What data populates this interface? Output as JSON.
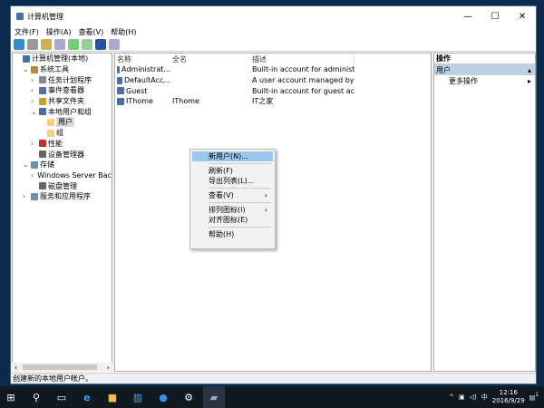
{
  "window": {
    "title": "计算机管理",
    "controls": [
      "—",
      "☐",
      "✕"
    ]
  },
  "menu": [
    "文件(F)",
    "操作(A)",
    "查看(V)",
    "帮助(H)"
  ],
  "tree": [
    {
      "label": "计算机管理(本地)",
      "indent": 0,
      "arrow": "",
      "color": "#4a6fa5"
    },
    {
      "label": "系统工具",
      "indent": 1,
      "arrow": "⌄",
      "color": "#b08a3e"
    },
    {
      "label": "任务计划程序",
      "indent": 2,
      "arrow": "›",
      "color": "#888"
    },
    {
      "label": "事件查看器",
      "indent": 2,
      "arrow": "›",
      "color": "#5a6fa0"
    },
    {
      "label": "共享文件夹",
      "indent": 2,
      "arrow": "›",
      "color": "#c8a030"
    },
    {
      "label": "本地用户和组",
      "indent": 2,
      "arrow": "⌄",
      "color": "#4a6fa5"
    },
    {
      "label": "用户",
      "indent": 3,
      "arrow": "",
      "color": "#f2d27a",
      "selected": true
    },
    {
      "label": "组",
      "indent": 3,
      "arrow": "",
      "color": "#f2d27a"
    },
    {
      "label": "性能",
      "indent": 2,
      "arrow": "›",
      "color": "#c03030"
    },
    {
      "label": "设备管理器",
      "indent": 2,
      "arrow": "",
      "color": "#666"
    },
    {
      "label": "存储",
      "indent": 1,
      "arrow": "⌄",
      "color": "#6a8fb5"
    },
    {
      "label": "Windows Server Back",
      "indent": 2,
      "arrow": "›",
      "color": "#3a9a3a"
    },
    {
      "label": "磁盘管理",
      "indent": 2,
      "arrow": "",
      "color": "#666"
    },
    {
      "label": "服务和应用程序",
      "indent": 1,
      "arrow": "›",
      "color": "#6a8fb5"
    }
  ],
  "list": {
    "headers": [
      "名称",
      "全名",
      "描述"
    ],
    "rows": [
      [
        "Administrat...",
        "",
        "Built-in account for administeri..."
      ],
      [
        "DefaultAcc...",
        "",
        "A user account managed by th..."
      ],
      [
        "Guest",
        "",
        "Built-in account for guest acce..."
      ],
      [
        "IThome",
        "IThome",
        "IT之家"
      ]
    ]
  },
  "actions": {
    "header": "操作",
    "section": "用户",
    "items": [
      "更多操作"
    ]
  },
  "context_menu": [
    {
      "label": "新用户(N)...",
      "highlight": true
    },
    {
      "sep": true
    },
    {
      "label": "刷新(F)"
    },
    {
      "label": "导出列表(L)..."
    },
    {
      "sep": true
    },
    {
      "label": "查看(V)",
      "sub": true
    },
    {
      "sep": true
    },
    {
      "label": "排列图标(I)",
      "sub": true
    },
    {
      "label": "对齐图标(E)"
    },
    {
      "sep": true
    },
    {
      "label": "帮助(H)"
    }
  ],
  "status": "创建新的本地用户帐户。",
  "taskbar": {
    "time": "12:16",
    "date": "2016/9/29",
    "notify_count": "1"
  }
}
